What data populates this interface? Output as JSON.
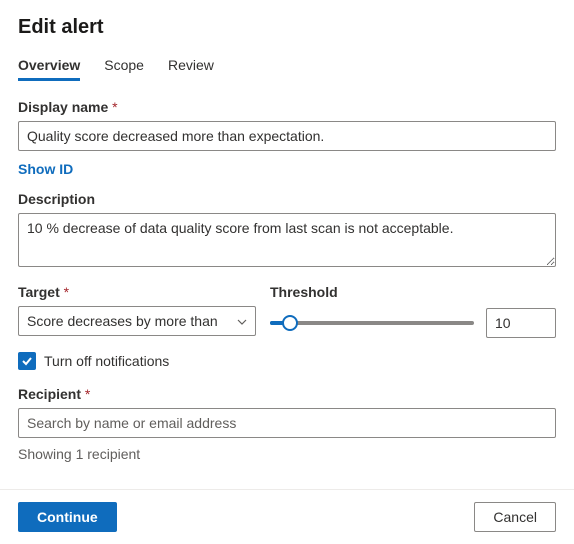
{
  "title": "Edit alert",
  "tabs": {
    "overview": "Overview",
    "scope": "Scope",
    "review": "Review"
  },
  "form": {
    "display_name_label": "Display name",
    "display_name_value": "Quality score decreased more than expectation.",
    "show_id_link": "Show ID",
    "description_label": "Description",
    "description_value": "10 % decrease of data quality score from last scan is not acceptable.",
    "target_label": "Target",
    "target_value": "Score decreases by more than",
    "threshold_label": "Threshold",
    "threshold_value": "10",
    "notifications_checkbox_label": "Turn off notifications",
    "recipient_label": "Recipient",
    "recipient_placeholder": "Search by name or email address",
    "recipient_count_text": "Showing 1 recipient"
  },
  "buttons": {
    "continue": "Continue",
    "cancel": "Cancel"
  }
}
